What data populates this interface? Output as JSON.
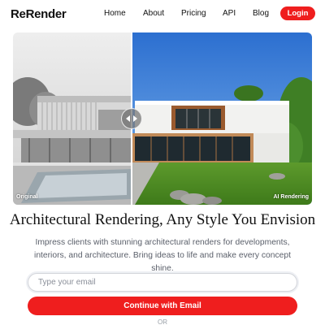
{
  "nav": {
    "logo": "ReRender",
    "links": [
      "Home",
      "About",
      "Pricing",
      "API",
      "Blog"
    ],
    "login": "Login"
  },
  "compare": {
    "left_label": "Original",
    "right_label": "AI Rendering"
  },
  "hero": {
    "headline": "Architectural Rendering, Any Style You Envision",
    "subtext": "Impress clients with stunning architectural renders for developments, interiors, and architecture. Bring ideas to life and make every concept shine."
  },
  "form": {
    "email_placeholder": "Type your email",
    "continue_label": "Continue with Email",
    "or_label": "OR"
  },
  "colors": {
    "accent": "#ef1e1e",
    "subtext": "#5a5f6a"
  }
}
